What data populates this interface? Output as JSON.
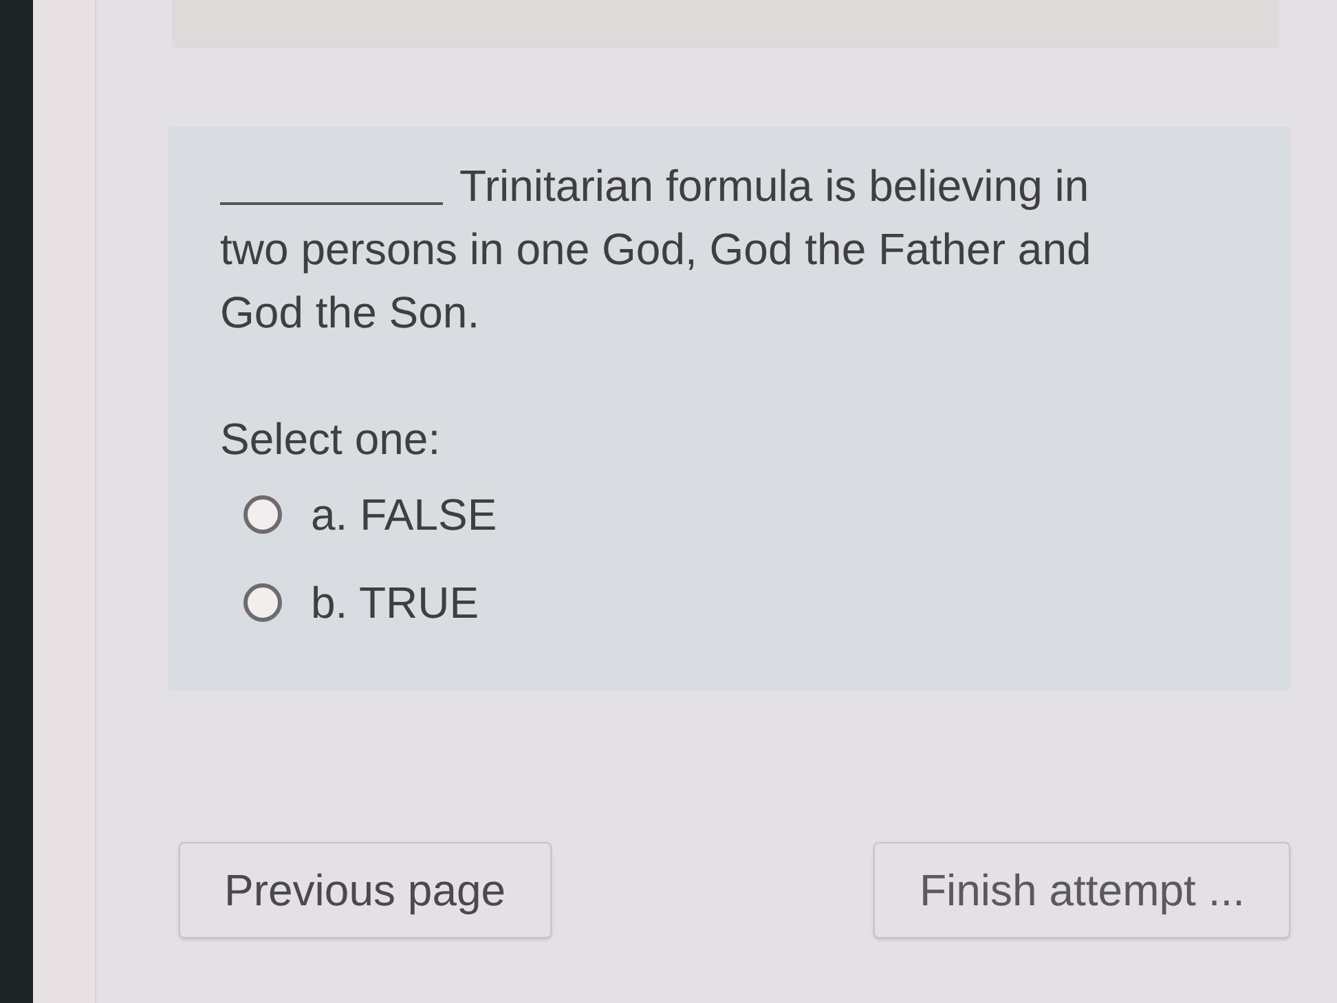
{
  "question": {
    "has_blank": true,
    "text_lines": [
      "Trinitarian formula is believing in",
      "two persons in one God, God the Father and",
      "God the Son."
    ],
    "prompt": "Select one:",
    "options": [
      {
        "label": "a. FALSE",
        "selected": false
      },
      {
        "label": "b. TRUE",
        "selected": false
      }
    ]
  },
  "navigation": {
    "buttons": [
      {
        "label": "Previous page"
      },
      {
        "label": "Finish attempt ..."
      }
    ]
  }
}
